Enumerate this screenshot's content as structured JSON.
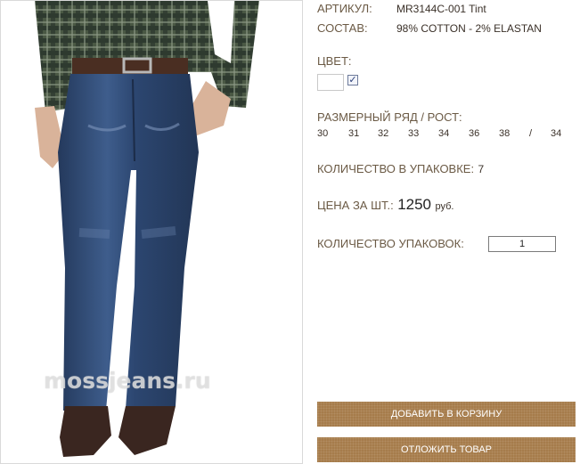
{
  "product": {
    "watermark": "mossjeans.ru",
    "sku_label": "АРТИКУЛ:",
    "sku_value": "MR3144C-001 Tint",
    "composition_label": "СОСТАВ:",
    "composition_value": "98% COTTON - 2% ELASTAN",
    "color_label": "ЦВЕТ:",
    "color_checked": true,
    "size_label": "РАЗМЕРНЫЙ РЯД / РОСТ:",
    "sizes": [
      "30",
      "31",
      "32",
      "33",
      "34",
      "36",
      "38",
      "/",
      "34"
    ],
    "pack_qty_label": "КОЛИЧЕСТВО В УПАКОВКЕ:",
    "pack_qty_value": "7",
    "price_label": "ЦЕНА ЗА ШТ.:",
    "price_value": "1250",
    "price_currency": "руб.",
    "packs_label": "КОЛИЧЕСТВО УПАКОВОК:",
    "packs_value": "1",
    "add_to_cart": "ДОБАВИТЬ В КОРЗИНУ",
    "postpone": "ОТЛОЖИТЬ ТОВАР"
  },
  "colors": {
    "label": "#6b5a45",
    "button": "#a67c4b",
    "denim": "#2f4a72"
  }
}
